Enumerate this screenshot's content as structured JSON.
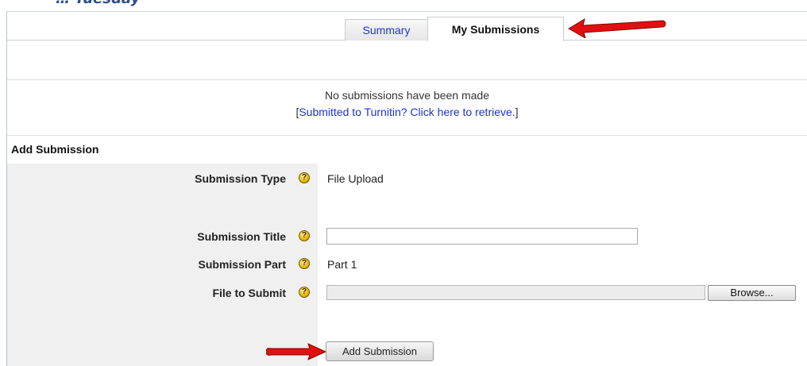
{
  "header": {
    "cut_title": "… Tuesday"
  },
  "tabs": [
    {
      "label": "Summary",
      "active": false
    },
    {
      "label": "My Submissions",
      "active": true
    }
  ],
  "messages": {
    "none": "No submissions have been made",
    "link_open": "[",
    "link": "Submitted to Turnitin? Click here to retrieve.",
    "link_close": "]"
  },
  "form": {
    "section_title": "Add Submission",
    "help_icon": "question-mark-icon",
    "submission_type": {
      "label": "Submission Type",
      "value": "File Upload"
    },
    "submission_title": {
      "label": "Submission Title",
      "value": "",
      "placeholder": ""
    },
    "submission_part": {
      "label": "Submission Part",
      "value": "Part 1"
    },
    "file_to_submit": {
      "label": "File to Submit",
      "value": "",
      "browse_label": "Browse..."
    },
    "submit_label": "Add Submission"
  },
  "colors": {
    "link": "#1a35c8",
    "panel": "#f0f0f0",
    "arrow": "#e01010",
    "help_icon": "#e6b400"
  }
}
